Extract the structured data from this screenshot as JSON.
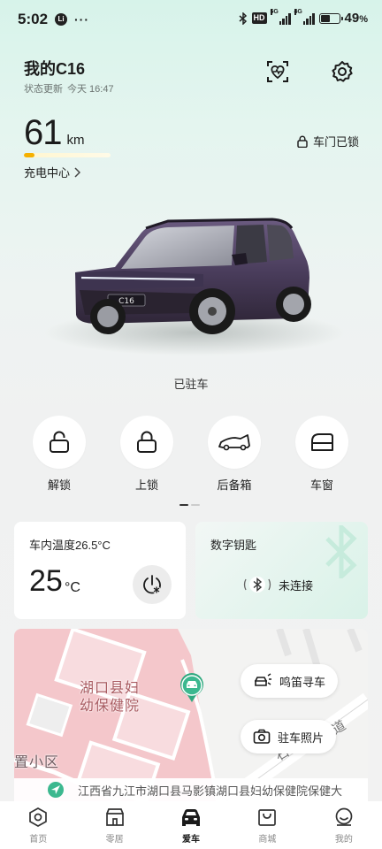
{
  "status_bar": {
    "time": "5:02",
    "left_dots": "···",
    "hd": "HD",
    "net1": "5G",
    "net2": "4G",
    "battery_percent": "49",
    "battery_unit": "%",
    "battery_level": 0.49
  },
  "header": {
    "car_name": "我的C16",
    "status_label": "状态更新",
    "status_time": "今天 16:47",
    "icons": {
      "health": "heart-monitor-icon",
      "settings": "gear-icon"
    }
  },
  "vehicle": {
    "range_value": "61",
    "range_unit": "km",
    "range_fraction": 0.12,
    "charge_center": "充电中心",
    "door_status": "车门已锁",
    "parking_status": "已驻车",
    "plate_badge": "C16",
    "body_color": "#4a3d5c"
  },
  "quick_controls": [
    {
      "label": "解锁",
      "icon": "lock-open-icon"
    },
    {
      "label": "上锁",
      "icon": "lock-closed-icon"
    },
    {
      "label": "后备箱",
      "icon": "car-trunk-icon"
    },
    {
      "label": "车窗",
      "icon": "car-window-icon"
    }
  ],
  "climate_card": {
    "title": "车内温度26.5°C",
    "set_temp": "25",
    "unit": "°C",
    "icon": "power-fan-icon"
  },
  "key_card": {
    "title": "数字钥匙",
    "status": "未连接",
    "icon": "bluetooth-icon"
  },
  "map": {
    "poi_name": "湖口县妇幼保健院",
    "poi_line1": "湖口县妇",
    "poi_line2": "幼保健院",
    "area_label": "置小区",
    "road_label": "石",
    "road_label2": "道",
    "honk_button": "鸣笛寻车",
    "photo_button": "驻车照片",
    "address": "江西省九江市湖口县马影镇湖口县妇幼保健院保健大"
  },
  "bottom_nav": [
    {
      "label": "首页",
      "icon": "home-hexagon-icon",
      "active": false
    },
    {
      "label": "零居",
      "icon": "shop-icon",
      "active": false
    },
    {
      "label": "爱车",
      "icon": "car-front-icon",
      "active": true
    },
    {
      "label": "商城",
      "icon": "shopping-bag-icon",
      "active": false
    },
    {
      "label": "我的",
      "icon": "profile-icon",
      "active": false
    }
  ],
  "colors": {
    "accent_green": "#3cb88f",
    "range_bar": "#f5b000",
    "map_pink": "#f3c8cc"
  }
}
